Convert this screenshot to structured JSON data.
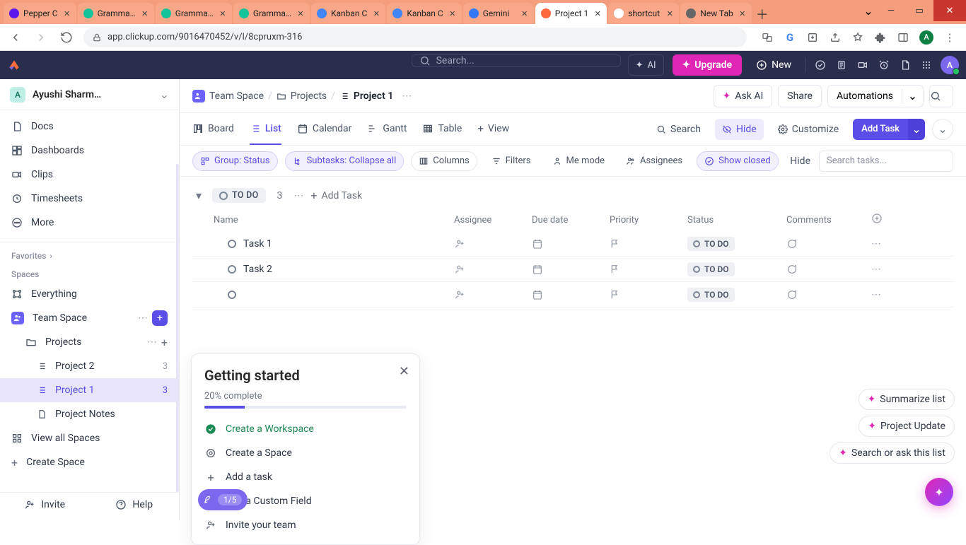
{
  "browser": {
    "tabs": [
      {
        "title": "Pepper C",
        "favicon_bg": "#5e17eb"
      },
      {
        "title": "Gramma…",
        "favicon_bg": "#15c39a"
      },
      {
        "title": "Gramma…",
        "favicon_bg": "#15c39a"
      },
      {
        "title": "Gramma…",
        "favicon_bg": "#15c39a"
      },
      {
        "title": "Kanban C",
        "favicon_bg": "#4285f4"
      },
      {
        "title": "Kanban C",
        "favicon_bg": "#4285f4"
      },
      {
        "title": "Gemini",
        "favicon_bg": "#3478f6"
      },
      {
        "title": "Project 1",
        "favicon_bg": "#ff6a3d",
        "active": true
      },
      {
        "title": "shortcut",
        "favicon_bg": "#ffffff"
      },
      {
        "title": "New Tab",
        "favicon_bg": "#666"
      }
    ],
    "url": "app.clickup.com/9016470452/v/l/8cpruxm-316",
    "profile_initial": "A"
  },
  "top": {
    "search_placeholder": "Search...",
    "ai_label": "AI",
    "upgrade": "Upgrade",
    "new": "New",
    "avatar_initial": "A"
  },
  "sidebar": {
    "workspace_initial": "A",
    "workspace_name": "Ayushi Sharm…",
    "nav": [
      {
        "icon": "doc",
        "label": "Docs"
      },
      {
        "icon": "dashboard",
        "label": "Dashboards"
      },
      {
        "icon": "clip",
        "label": "Clips"
      },
      {
        "icon": "timesheet",
        "label": "Timesheets"
      },
      {
        "icon": "more",
        "label": "More"
      }
    ],
    "favorites_label": "Favorites",
    "spaces_label": "Spaces",
    "everything": "Everything",
    "team_space": "Team Space",
    "projects_folder": "Projects",
    "lists": [
      {
        "label": "Project 2",
        "count": "3"
      },
      {
        "label": "Project 1",
        "count": "3",
        "active": true
      },
      {
        "label": "Project Notes"
      }
    ],
    "view_all_spaces": "View all Spaces",
    "create_space": "Create Space",
    "invite": "Invite",
    "help": "Help"
  },
  "breadcrumb": {
    "team": "Team Space",
    "folder": "Projects",
    "list": "Project 1"
  },
  "header_actions": {
    "ask_ai": "Ask AI",
    "share": "Share",
    "automations": "Automations"
  },
  "views": {
    "board": "Board",
    "list": "List",
    "calendar": "Calendar",
    "gantt": "Gantt",
    "table": "Table",
    "view": "View",
    "search": "Search",
    "hide": "Hide",
    "customize": "Customize",
    "add_task": "Add Task"
  },
  "filters": {
    "group": "Group: Status",
    "subtasks": "Subtasks: Collapse all",
    "columns": "Columns",
    "filters": "Filters",
    "me_mode": "Me mode",
    "assignees": "Assignees",
    "show_closed": "Show closed",
    "hide": "Hide",
    "search_placeholder": "Search tasks..."
  },
  "group": {
    "status": "TO DO",
    "count": "3",
    "add_task": "Add Task"
  },
  "columns": {
    "name": "Name",
    "assignee": "Assignee",
    "due": "Due date",
    "priority": "Priority",
    "status": "Status",
    "comments": "Comments"
  },
  "tasks": [
    {
      "name": "Task 1",
      "status": "TO DO"
    },
    {
      "name": "Task 2",
      "status": "TO DO"
    },
    {
      "name": "",
      "status": "TO DO"
    }
  ],
  "getting_started": {
    "title": "Getting started",
    "progress_text": "20% complete",
    "progress_pct": 20,
    "items": [
      {
        "label": "Create a Workspace",
        "done": true
      },
      {
        "label": "Create a Space"
      },
      {
        "label": "Add a task"
      },
      {
        "label": "Add a Custom Field"
      },
      {
        "label": "Invite your team"
      }
    ],
    "quick_pill": "1/5"
  },
  "float": {
    "summarize": "Summarize list",
    "project_update": "Project Update",
    "ask_list": "Search or ask this list"
  }
}
